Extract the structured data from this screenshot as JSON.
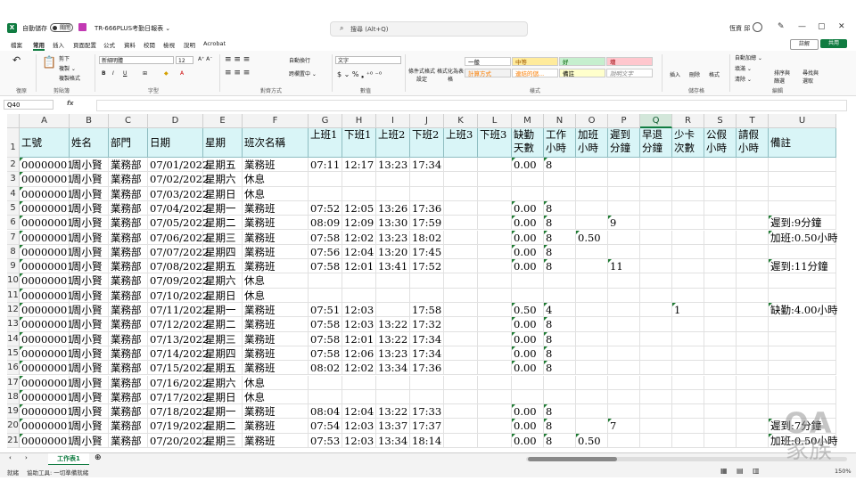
{
  "titlebar": {
    "app_logo": "X",
    "autosave_label": "自動儲存",
    "autosave_state": "關閉",
    "doc_title": "TR-666PLUS考勤日報表 ⌄",
    "search_placeholder": "搜尋 (Alt+Q)",
    "user_name": "恆資 邱"
  },
  "menu": {
    "items": [
      "檔案",
      "常用",
      "插入",
      "頁面配置",
      "公式",
      "資料",
      "校閱",
      "檢視",
      "說明",
      "Acrobat"
    ],
    "active": "常用",
    "comment_label": "註解",
    "share_label": "共用"
  },
  "ribbon": {
    "clipboard": {
      "cut": "剪下",
      "copy": "複製 ⌄",
      "format_painter": "複製格式",
      "paste": "貼上",
      "label": "剪貼簿"
    },
    "undo_label": "復原",
    "font": {
      "name": "新細明體",
      "size": "12",
      "label": "字型"
    },
    "alignment": {
      "wrap": "自動換行",
      "merge": "跨欄置中 ⌄",
      "label": "對齊方式"
    },
    "number": {
      "format": "文字",
      "label": "數值"
    },
    "styles": {
      "cond_format": "條件式格式設定",
      "format_table": "格式化為表格",
      "cells": [
        {
          "text": "一般",
          "bg": "#ffffff",
          "fg": "#000000"
        },
        {
          "text": "中等",
          "bg": "#ffeb9c",
          "fg": "#9c5700"
        },
        {
          "text": "好",
          "bg": "#c6efce",
          "fg": "#006100"
        },
        {
          "text": "壞",
          "bg": "#ffc7ce",
          "fg": "#9c0006"
        },
        {
          "text": "計算方式",
          "bg": "#f2f2f2",
          "fg": "#fa7d00"
        },
        {
          "text": "連結的儲...",
          "bg": "#ffffff",
          "fg": "#fa7d00"
        },
        {
          "text": "備註",
          "bg": "#ffffcc",
          "fg": "#000000"
        },
        {
          "text": "說明文字",
          "bg": "#ffffff",
          "fg": "#7f7f7f"
        }
      ],
      "label": "樣式"
    },
    "cells_group": {
      "insert": "插入",
      "delete": "刪除",
      "format": "格式",
      "label": "儲存格"
    },
    "editing": {
      "autosum": "自動加總 ⌄",
      "fill": "填滿 ⌄",
      "clear": "清除 ⌄",
      "sort": "排序與篩選",
      "find": "尋找與選取",
      "label": "編輯"
    }
  },
  "formula_bar": {
    "name_box": "Q40",
    "fx": "fx",
    "value": ""
  },
  "columns": [
    "A",
    "B",
    "C",
    "D",
    "E",
    "F",
    "G",
    "H",
    "I",
    "J",
    "K",
    "L",
    "M",
    "N",
    "O",
    "P",
    "Q",
    "R",
    "S",
    "T",
    "U"
  ],
  "selected_column": "Q",
  "header_row": [
    "工號",
    "姓名",
    "部門",
    "日期",
    "星期",
    "班次名稱",
    "上班1",
    "下班1",
    "上班2",
    "下班2",
    "上班3",
    "下班3",
    "缺勤天數",
    "工作小時",
    "加班小時",
    "遲到分鐘",
    "早退分鐘",
    "少卡次數",
    "公假小時",
    "請假小時",
    "備註"
  ],
  "rows": [
    {
      "num": "2",
      "cells": [
        "00000001",
        "周小賢",
        "業務部",
        "07/01/2022",
        "星期五",
        "業務班",
        "07:11",
        "12:17",
        "13:23",
        "17:34",
        "",
        "",
        "0.00",
        "8",
        "",
        "",
        "",
        "",
        "",
        "",
        ""
      ]
    },
    {
      "num": "3",
      "cells": [
        "00000001",
        "周小賢",
        "業務部",
        "07/02/2022",
        "星期六",
        "休息",
        "",
        "",
        "",
        "",
        "",
        "",
        "",
        "",
        "",
        "",
        "",
        "",
        "",
        "",
        ""
      ]
    },
    {
      "num": "4",
      "cells": [
        "00000001",
        "周小賢",
        "業務部",
        "07/03/2022",
        "星期日",
        "休息",
        "",
        "",
        "",
        "",
        "",
        "",
        "",
        "",
        "",
        "",
        "",
        "",
        "",
        "",
        ""
      ]
    },
    {
      "num": "5",
      "cells": [
        "00000001",
        "周小賢",
        "業務部",
        "07/04/2022",
        "星期一",
        "業務班",
        "07:52",
        "12:05",
        "13:26",
        "17:36",
        "",
        "",
        "0.00",
        "8",
        "",
        "",
        "",
        "",
        "",
        "",
        ""
      ]
    },
    {
      "num": "6",
      "cells": [
        "00000001",
        "周小賢",
        "業務部",
        "07/05/2022",
        "星期二",
        "業務班",
        "08:09",
        "12:09",
        "13:30",
        "17:59",
        "",
        "",
        "0.00",
        "8",
        "",
        "9",
        "",
        "",
        "",
        "",
        "遲到:9分鐘"
      ]
    },
    {
      "num": "7",
      "cells": [
        "00000001",
        "周小賢",
        "業務部",
        "07/06/2022",
        "星期三",
        "業務班",
        "07:58",
        "12:02",
        "13:23",
        "18:02",
        "",
        "",
        "0.00",
        "8",
        "0.50",
        "",
        "",
        "",
        "",
        "",
        "加班:0.50小時"
      ]
    },
    {
      "num": "8",
      "cells": [
        "00000001",
        "周小賢",
        "業務部",
        "07/07/2022",
        "星期四",
        "業務班",
        "07:56",
        "12:04",
        "13:20",
        "17:45",
        "",
        "",
        "0.00",
        "8",
        "",
        "",
        "",
        "",
        "",
        "",
        ""
      ]
    },
    {
      "num": "9",
      "cells": [
        "00000001",
        "周小賢",
        "業務部",
        "07/08/2022",
        "星期五",
        "業務班",
        "07:58",
        "12:01",
        "13:41",
        "17:52",
        "",
        "",
        "0.00",
        "8",
        "",
        "11",
        "",
        "",
        "",
        "",
        "遲到:11分鐘"
      ]
    },
    {
      "num": "10",
      "cells": [
        "00000001",
        "周小賢",
        "業務部",
        "07/09/2022",
        "星期六",
        "休息",
        "",
        "",
        "",
        "",
        "",
        "",
        "",
        "",
        "",
        "",
        "",
        "",
        "",
        "",
        ""
      ]
    },
    {
      "num": "11",
      "cells": [
        "00000001",
        "周小賢",
        "業務部",
        "07/10/2022",
        "星期日",
        "休息",
        "",
        "",
        "",
        "",
        "",
        "",
        "",
        "",
        "",
        "",
        "",
        "",
        "",
        "",
        ""
      ]
    },
    {
      "num": "12",
      "cells": [
        "00000001",
        "周小賢",
        "業務部",
        "07/11/2022",
        "星期一",
        "業務班",
        "07:51",
        "12:03",
        "",
        "17:58",
        "",
        "",
        "0.50",
        "4",
        "",
        "",
        "",
        "1",
        "",
        "",
        "缺勤:4.00小時"
      ]
    },
    {
      "num": "13",
      "cells": [
        "00000001",
        "周小賢",
        "業務部",
        "07/12/2022",
        "星期二",
        "業務班",
        "07:58",
        "12:03",
        "13:22",
        "17:32",
        "",
        "",
        "0.00",
        "8",
        "",
        "",
        "",
        "",
        "",
        "",
        ""
      ]
    },
    {
      "num": "14",
      "cells": [
        "00000001",
        "周小賢",
        "業務部",
        "07/13/2022",
        "星期三",
        "業務班",
        "07:58",
        "12:01",
        "13:22",
        "17:34",
        "",
        "",
        "0.00",
        "8",
        "",
        "",
        "",
        "",
        "",
        "",
        ""
      ]
    },
    {
      "num": "15",
      "cells": [
        "00000001",
        "周小賢",
        "業務部",
        "07/14/2022",
        "星期四",
        "業務班",
        "07:58",
        "12:06",
        "13:23",
        "17:34",
        "",
        "",
        "0.00",
        "8",
        "",
        "",
        "",
        "",
        "",
        "",
        ""
      ]
    },
    {
      "num": "16",
      "cells": [
        "00000001",
        "周小賢",
        "業務部",
        "07/15/2022",
        "星期五",
        "業務班",
        "08:02",
        "12:02",
        "13:34",
        "17:36",
        "",
        "",
        "0.00",
        "8",
        "",
        "",
        "",
        "",
        "",
        "",
        ""
      ]
    },
    {
      "num": "17",
      "cells": [
        "00000001",
        "周小賢",
        "業務部",
        "07/16/2022",
        "星期六",
        "休息",
        "",
        "",
        "",
        "",
        "",
        "",
        "",
        "",
        "",
        "",
        "",
        "",
        "",
        "",
        ""
      ]
    },
    {
      "num": "18",
      "cells": [
        "00000001",
        "周小賢",
        "業務部",
        "07/17/2022",
        "星期日",
        "休息",
        "",
        "",
        "",
        "",
        "",
        "",
        "",
        "",
        "",
        "",
        "",
        "",
        "",
        "",
        ""
      ]
    },
    {
      "num": "19",
      "cells": [
        "00000001",
        "周小賢",
        "業務部",
        "07/18/2022",
        "星期一",
        "業務班",
        "08:04",
        "12:04",
        "13:22",
        "17:33",
        "",
        "",
        "0.00",
        "8",
        "",
        "",
        "",
        "",
        "",
        "",
        ""
      ]
    },
    {
      "num": "20",
      "cells": [
        "00000001",
        "周小賢",
        "業務部",
        "07/19/2022",
        "星期二",
        "業務班",
        "07:54",
        "12:03",
        "13:37",
        "17:37",
        "",
        "",
        "0.00",
        "8",
        "",
        "7",
        "",
        "",
        "",
        "",
        "遲到:7分鐘"
      ]
    },
    {
      "num": "21",
      "cells": [
        "00000001",
        "周小賢",
        "業務部",
        "07/20/2022",
        "星期三",
        "業務班",
        "07:53",
        "12:03",
        "13:34",
        "18:14",
        "",
        "",
        "0.00",
        "8",
        "0.50",
        "",
        "",
        "",
        "",
        "",
        "加班:0.50小時"
      ]
    }
  ],
  "sheet_tab": "工作表1",
  "status": {
    "ready": "就緒",
    "accessibility": "協助工具: 一切準備就緒",
    "zoom": "150%"
  },
  "watermark": {
    "top": "OA",
    "bottom": "家族"
  }
}
